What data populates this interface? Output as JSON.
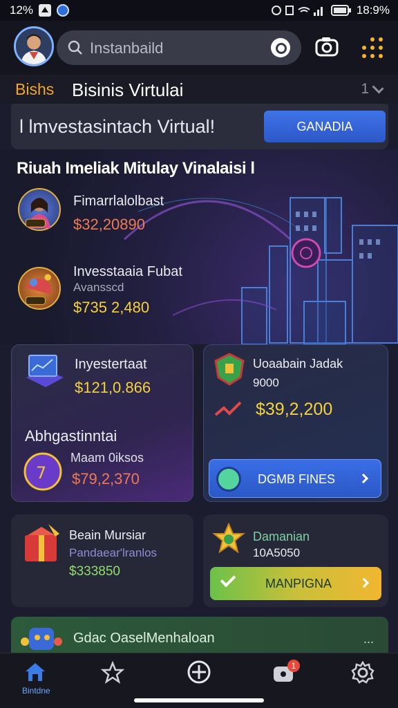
{
  "status_bar": {
    "time_left": "12%",
    "time_right": "18:9%"
  },
  "header": {
    "search_placeholder": "Instanbaild"
  },
  "title_row": {
    "tag": "Bishs",
    "title": "Bisinis Virtulai",
    "count": "1"
  },
  "banner": {
    "text": "l lmvestasintach Virtual!",
    "button": "GANADIA"
  },
  "section": {
    "heading": "Riuah Imeliak Mitulay Vinalaisi l",
    "items": [
      {
        "title": "Fimarrlalolbast",
        "amount": "$32,20890",
        "amount_color": "#f07a52"
      },
      {
        "title": "Invesstaaia Fubat",
        "subtitle": "Avansscd",
        "amount": "$735 2,480",
        "amount_color": "#f6d23a"
      }
    ]
  },
  "card_a": {
    "title": "Inyestertaat",
    "amount": "$121,0.866",
    "heading": "Abhgastinntai",
    "sub_title": "Maam 0iksos",
    "sub_amount": "$79,2,370"
  },
  "card_b": {
    "title": "Uoaabain Jadak",
    "sub": "9000",
    "amount": "$39,2,200",
    "button": "DGMB FINES"
  },
  "card_c": {
    "title": "Beain Mursiar",
    "subtitle": "Pandaear'lranlos",
    "amount": "$333850"
  },
  "card_d": {
    "title": "Damanian",
    "sub": "10A5050",
    "button": "MANPIGNA"
  },
  "card_e": {
    "title": "Gdac OaselMenhaloan",
    "more": "..."
  },
  "bottom_nav": {
    "home_label": "Bintdne",
    "badge": "1"
  }
}
